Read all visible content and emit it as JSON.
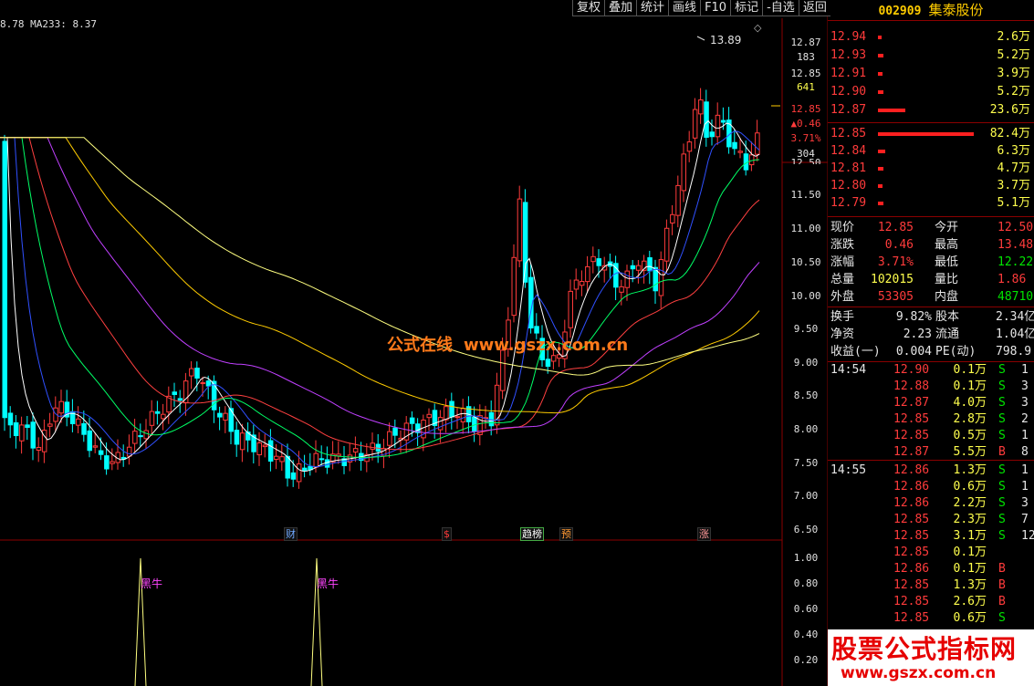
{
  "toolbar": [
    "复权",
    "叠加",
    "统计",
    "画线",
    "F10",
    "标记",
    "-自选",
    "返回"
  ],
  "ma_readout": "8.78  MA233: 8.37",
  "price_axis": {
    "labels": [
      "12.87",
      "12.85",
      "12.50",
      "11.50",
      "11.00",
      "10.50",
      "10.00",
      "9.50",
      "9.00",
      "8.50",
      "8.00",
      "7.50",
      "7.00",
      "6.50"
    ],
    "info_183": "183",
    "info_641": "641",
    "info_price": "12.85",
    "info_change": "▲0.46",
    "info_pct": "3.71%",
    "info_304": "304"
  },
  "indicator_axis": [
    "1.00",
    "0.80",
    "0.60",
    "0.40",
    "0.20"
  ],
  "peak_label": "13.89",
  "watermark_text": "公式在线",
  "watermark_url": "www.gszx.com.cn",
  "events": [
    {
      "text": "财",
      "color": "#6fa8ff"
    },
    {
      "text": "$",
      "color": "#ff3b3b"
    },
    {
      "text": "趋榜",
      "color": "#ffffff"
    },
    {
      "text": "预",
      "color": "#ff9933"
    },
    {
      "text": "涨",
      "color": "#ff9999"
    }
  ],
  "indicator_labels": [
    "黑牛",
    "黑牛"
  ],
  "stock": {
    "code": "002909",
    "name": "集泰股份"
  },
  "sell_orders": [
    {
      "price": "12.94",
      "vol": "2.6万",
      "bar": 0.03
    },
    {
      "price": "12.93",
      "vol": "5.2万",
      "bar": 0.06
    },
    {
      "price": "12.91",
      "vol": "3.9万",
      "bar": 0.05
    },
    {
      "price": "12.90",
      "vol": "5.2万",
      "bar": 0.06
    },
    {
      "price": "12.87",
      "vol": "23.6万",
      "bar": 0.29
    }
  ],
  "buy_orders": [
    {
      "price": "12.85",
      "vol": "82.4万",
      "bar": 1.0
    },
    {
      "price": "12.84",
      "vol": "6.3万",
      "bar": 0.08
    },
    {
      "price": "12.81",
      "vol": "4.7万",
      "bar": 0.06
    },
    {
      "price": "12.80",
      "vol": "3.7万",
      "bar": 0.05
    },
    {
      "price": "12.79",
      "vol": "5.1万",
      "bar": 0.06
    }
  ],
  "quote": {
    "now_label": "现价",
    "now": "12.85",
    "open_label": "今开",
    "open": "12.50",
    "chg_label": "涨跌",
    "chg": "0.46",
    "high_label": "最高",
    "high": "13.48",
    "pct_label": "涨幅",
    "pct": "3.71%",
    "low_label": "最低",
    "low": "12.22",
    "vol_label": "总量",
    "vol": "102015",
    "vr_label": "量比",
    "vr": "1.86",
    "out_label": "外盘",
    "out": "53305",
    "in_label": "内盘",
    "in": "48710"
  },
  "fund": {
    "turn_label": "换手",
    "turn": "9.82%",
    "cap_label": "股本",
    "cap": "2.34亿",
    "na_label": "净资",
    "na": "2.23",
    "float_label": "流通",
    "float": "1.04亿",
    "eps_label": "收益(一)",
    "eps": "0.004",
    "pe_label": "PE(动)",
    "pe": "798.9"
  },
  "ticks": [
    {
      "time": "14:54",
      "price": "12.90",
      "vol": "0.1万",
      "side": "S"
    },
    {
      "time": "",
      "price": "12.88",
      "vol": "0.1万",
      "side": "S"
    },
    {
      "time": "",
      "price": "12.87",
      "vol": "4.0万",
      "side": "S"
    },
    {
      "time": "",
      "price": "12.85",
      "vol": "2.8万",
      "side": "S"
    },
    {
      "time": "",
      "price": "12.85",
      "vol": "0.5万",
      "side": "S"
    },
    {
      "time": "",
      "price": "12.87",
      "vol": "5.5万",
      "side": "B"
    },
    {
      "time": "14:55",
      "price": "12.86",
      "vol": "1.3万",
      "side": "S"
    },
    {
      "time": "",
      "price": "12.86",
      "vol": "0.6万",
      "side": "S"
    },
    {
      "time": "",
      "price": "12.86",
      "vol": "2.2万",
      "side": "S"
    },
    {
      "time": "",
      "price": "12.85",
      "vol": "2.3万",
      "side": "S"
    },
    {
      "time": "",
      "price": "12.85",
      "vol": "3.1万",
      "side": "S"
    },
    {
      "time": "",
      "price": "12.85",
      "vol": "0.1万",
      "side": ""
    },
    {
      "time": "",
      "price": "12.86",
      "vol": "0.1万",
      "side": "B"
    },
    {
      "time": "",
      "price": "12.85",
      "vol": "1.3万",
      "side": "B"
    },
    {
      "time": "",
      "price": "12.85",
      "vol": "2.6万",
      "side": "B"
    },
    {
      "time": "",
      "price": "12.85",
      "vol": "0.6万",
      "side": "S"
    }
  ],
  "tick_extra": [
    "1",
    "3",
    "3",
    "2",
    "1",
    "8",
    "1",
    "1",
    "3",
    "7",
    "12",
    "",
    "",
    "",
    "",
    ""
  ],
  "logo": {
    "main": "股票公式指标网",
    "sub": "www.gszx.com.cn"
  },
  "colors": {
    "up": "#ff3b3b",
    "down": "#00ffff",
    "ma5": "#ffffff",
    "ma10": "#ffff00",
    "ma20": "#ff00ff",
    "ma30": "#00ff00",
    "ma60": "#ff4040",
    "ma120": "#c040ff",
    "ma233": "#ffff80"
  }
}
